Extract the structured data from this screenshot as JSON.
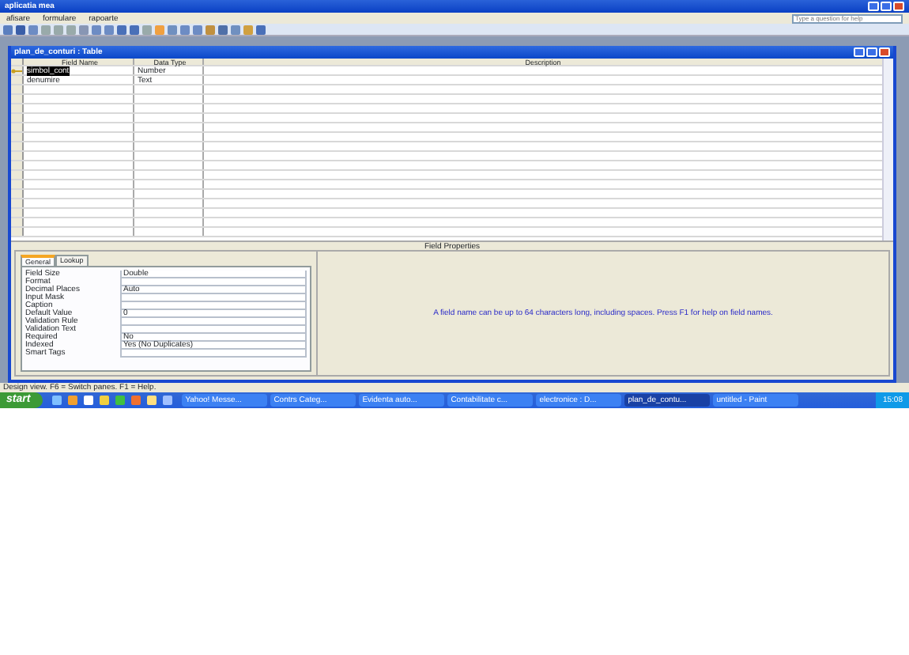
{
  "window": {
    "title": "aplicatia mea"
  },
  "menu": [
    "afisare",
    "formulare",
    "rapoarte"
  ],
  "help_box": {
    "placeholder": "Type a question for help"
  },
  "table_window": {
    "title": "plan_de_conturi : Table",
    "columns": [
      "Field Name",
      "Data Type",
      "Description"
    ],
    "rows": [
      {
        "field_name": "simbol_cont",
        "data_type": "Number",
        "selected": true
      },
      {
        "field_name": "denumire",
        "data_type": "Text",
        "selected": false
      }
    ],
    "properties_title": "Field Properties",
    "tabs": [
      {
        "label": "General",
        "selected": true
      },
      {
        "label": "Lookup",
        "selected": false
      }
    ],
    "properties": [
      {
        "label": "Field Size",
        "value": "Double"
      },
      {
        "label": "Format"
      },
      {
        "label": "Decimal Places",
        "value": "Auto"
      },
      {
        "label": "Input Mask"
      },
      {
        "label": "Caption"
      },
      {
        "label": "Default Value",
        "value": "0"
      },
      {
        "label": "Validation Rule"
      },
      {
        "label": "Validation Text"
      },
      {
        "label": "Required",
        "value": "No"
      },
      {
        "label": "Indexed",
        "value": "Yes (No Duplicates)"
      },
      {
        "label": "Smart Tags"
      }
    ],
    "hint": "A field name can be up to 64 characters long, including spaces.  Press F1 for help on field names."
  },
  "status_bar": "Design view.  F6 = Switch panes.  F1 = Help.",
  "taskbar": {
    "start": "start",
    "tasks": [
      {
        "label": "Yahoo! Messe...",
        "selected": false
      },
      {
        "label": "Contrs Categ...",
        "selected": false
      },
      {
        "label": "Evidenta auto...",
        "selected": false
      },
      {
        "label": "Contabilitate c...",
        "selected": false
      },
      {
        "label": "electronice : D...",
        "selected": false
      },
      {
        "label": "plan_de_contu...",
        "selected": true
      },
      {
        "label": "untitled - Paint",
        "selected": false
      }
    ],
    "clock": "15:08"
  }
}
